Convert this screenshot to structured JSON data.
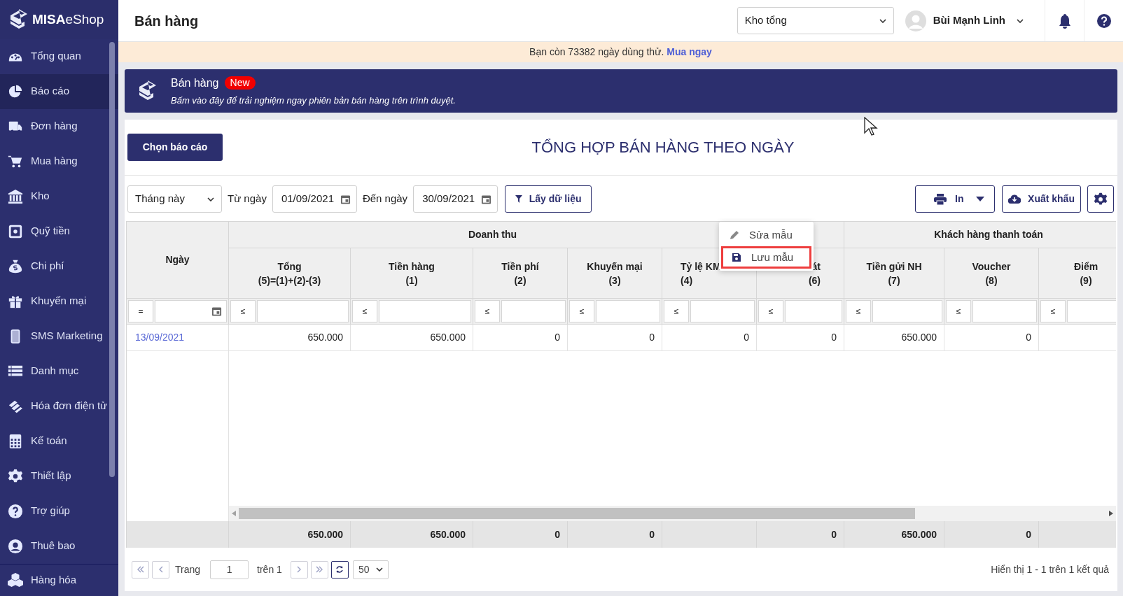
{
  "sidebar": {
    "logo": "MISA",
    "logo_suffix": "eShop",
    "items": [
      {
        "label": "Tổng quan",
        "selected": false
      },
      {
        "label": "Báo cáo",
        "selected": true
      },
      {
        "label": "Đơn hàng",
        "selected": false
      },
      {
        "label": "Mua hàng",
        "selected": false
      },
      {
        "label": "Kho",
        "selected": false
      },
      {
        "label": "Quỹ tiền",
        "selected": false
      },
      {
        "label": "Chi phí",
        "selected": false
      },
      {
        "label": "Khuyến mại",
        "selected": false
      },
      {
        "label": "SMS Marketing",
        "selected": false
      },
      {
        "label": "Danh mục",
        "selected": false
      },
      {
        "label": "Hóa đơn điện tử",
        "selected": false
      },
      {
        "label": "Kế toán",
        "selected": false
      },
      {
        "label": "Thiết lập",
        "selected": false
      },
      {
        "label": "Trợ giúp",
        "selected": false
      },
      {
        "label": "Thuê bao",
        "selected": false
      }
    ],
    "footer_item": {
      "label": "Hàng hóa",
      "selected": false
    }
  },
  "header": {
    "title": "Bán hàng",
    "store_select": "Kho tổng",
    "user": "Bùi Mạnh Linh"
  },
  "trial_notice": {
    "text": "Bạn còn 73382 ngày dùng thử.",
    "link": "Mua ngay"
  },
  "banner": {
    "title": "Bán hàng",
    "badge": "New",
    "subtitle": "Bấm vào đây để trải nghiệm ngay phiên bản bán hàng trên trình duyệt."
  },
  "report": {
    "choose_button": "Chọn báo cáo",
    "title": "TỔNG HỢP BÁN HÀNG THEO NGÀY",
    "period_select": "Tháng này",
    "from_label": "Từ ngày",
    "from_date": "01/09/2021",
    "to_label": "Đến ngày",
    "to_date": "30/09/2021",
    "fetch_button": "Lấy dữ liệu",
    "print_button": "In",
    "export_button": "Xuất khẩu"
  },
  "table": {
    "date_column": {
      "title": "Ngày",
      "filter_operator": "="
    },
    "column_groups": [
      {
        "label": "Doanh thu",
        "columns": [
          {
            "title": "Tổng",
            "subtitle": "(5)=(1)+(2)-(3)",
            "filter_operator": "≤",
            "total": "650.000"
          },
          {
            "title": "Tiền hàng",
            "subtitle": "(1)",
            "filter_operator": "≤",
            "total": "650.000"
          },
          {
            "title": "Tiền phí",
            "subtitle": "(2)",
            "filter_operator": "≤",
            "total": "0"
          },
          {
            "title": "Khuyến mại",
            "subtitle": "(3)",
            "filter_operator": "≤",
            "total": "0"
          },
          {
            "title": "Tỷ lệ KM",
            "subtitle": "(4)",
            "filter_operator": "≤"
          }
        ]
      },
      {
        "columns": [
          {
            "title": "át",
            "subtitle": "(6)",
            "filter_operator": "≤",
            "total": "0"
          }
        ]
      },
      {
        "label": "Khách hàng thanh toán",
        "columns": [
          {
            "title": "Tiền gửi NH",
            "subtitle": "(7)",
            "filter_operator": "≤",
            "total": "650.000"
          },
          {
            "title": "Voucher",
            "subtitle": "(8)",
            "filter_operator": "≤",
            "total": "0"
          },
          {
            "title": "Điểm",
            "subtitle": "(9)",
            "filter_operator": "≤"
          }
        ]
      }
    ],
    "rows": [
      {
        "date": "13/09/2021",
        "cells": [
          "650.000",
          "650.000",
          "0",
          "0",
          "0",
          "0",
          "650.000",
          "0"
        ]
      }
    ]
  },
  "pagination": {
    "page_label": "Trang",
    "page": "1",
    "of_label": "trên 1",
    "page_size": "50",
    "summary": "Hiển thị 1 - 1 trên 1 kết quả"
  },
  "context_menu": {
    "items": [
      {
        "label": "Sửa mẫu",
        "highlighted": false
      },
      {
        "label": "Lưu mẫu",
        "highlighted": true
      }
    ]
  }
}
